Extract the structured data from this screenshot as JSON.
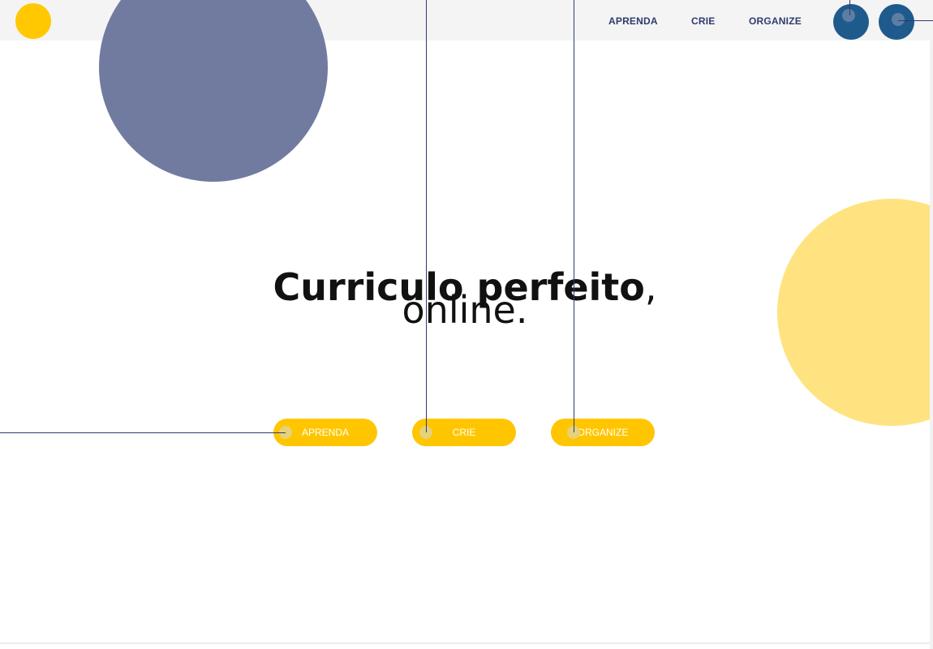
{
  "header": {
    "nav": {
      "aprenda": "APRENDA",
      "crie": "CRIE",
      "organize": "ORGANIZE"
    }
  },
  "hero": {
    "title_strong": "Curriculo perfeito",
    "title_comma": ",",
    "title_line2": "online."
  },
  "actions": {
    "aprenda": "APRENDA",
    "crie": "CRIE",
    "organize": "ORGANIZE"
  },
  "colors": {
    "accent_yellow": "#ffc600",
    "light_yellow": "#fee380",
    "navy": "#2e3b6e",
    "blue_button": "#1f5a8d",
    "muted_blue": "#717b9f"
  }
}
